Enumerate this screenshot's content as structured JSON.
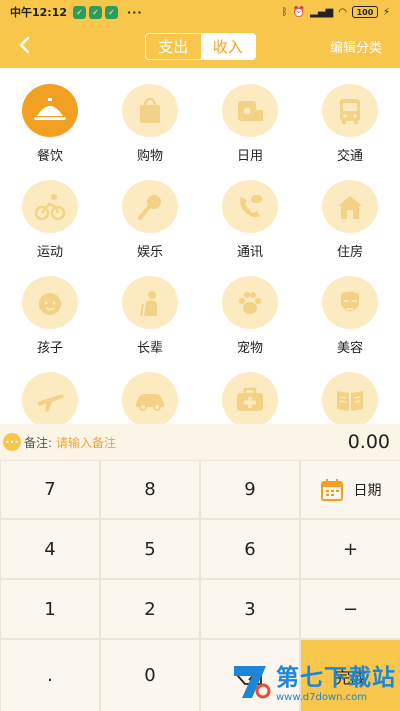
{
  "status": {
    "time": "中午12:12",
    "dots": "···",
    "battery": "100"
  },
  "header": {
    "tabs": [
      {
        "label": "支出",
        "active": true
      },
      {
        "label": "收入",
        "active": false
      }
    ],
    "edit": "编辑分类"
  },
  "categories": [
    {
      "label": "餐饮",
      "icon": "dining-cloche-icon",
      "selected": true
    },
    {
      "label": "购物",
      "icon": "shopping-bag-icon"
    },
    {
      "label": "日用",
      "icon": "tissue-roll-icon"
    },
    {
      "label": "交通",
      "icon": "bus-icon"
    },
    {
      "label": "运动",
      "icon": "cycling-icon"
    },
    {
      "label": "娱乐",
      "icon": "microphone-icon"
    },
    {
      "label": "通讯",
      "icon": "phone-icon"
    },
    {
      "label": "住房",
      "icon": "house-icon"
    },
    {
      "label": "孩子",
      "icon": "child-face-icon"
    },
    {
      "label": "长辈",
      "icon": "elder-icon"
    },
    {
      "label": "宠物",
      "icon": "paw-icon"
    },
    {
      "label": "美容",
      "icon": "face-mask-icon"
    },
    {
      "label": "",
      "icon": "airplane-icon"
    },
    {
      "label": "",
      "icon": "car-icon"
    },
    {
      "label": "",
      "icon": "medical-kit-icon"
    },
    {
      "label": "",
      "icon": "book-icon"
    }
  ],
  "note": {
    "label": "备注:",
    "placeholder": "请输入备注",
    "amount": "0.00"
  },
  "keypad": {
    "k7": "7",
    "k8": "8",
    "k9": "9",
    "date": "日期",
    "k4": "4",
    "k5": "5",
    "k6": "6",
    "plus": "+",
    "k1": "1",
    "k2": "2",
    "k3": "3",
    "minus": "−",
    "dot": ".",
    "k0": "0",
    "done": "完成"
  },
  "watermark": {
    "title": "第七下载站",
    "url": "www.d7down.com"
  },
  "colors": {
    "accent": "#f8c64b",
    "selected": "#f2a021",
    "icon_bg": "#fcebc0",
    "icon_fg": "#f3d186"
  }
}
